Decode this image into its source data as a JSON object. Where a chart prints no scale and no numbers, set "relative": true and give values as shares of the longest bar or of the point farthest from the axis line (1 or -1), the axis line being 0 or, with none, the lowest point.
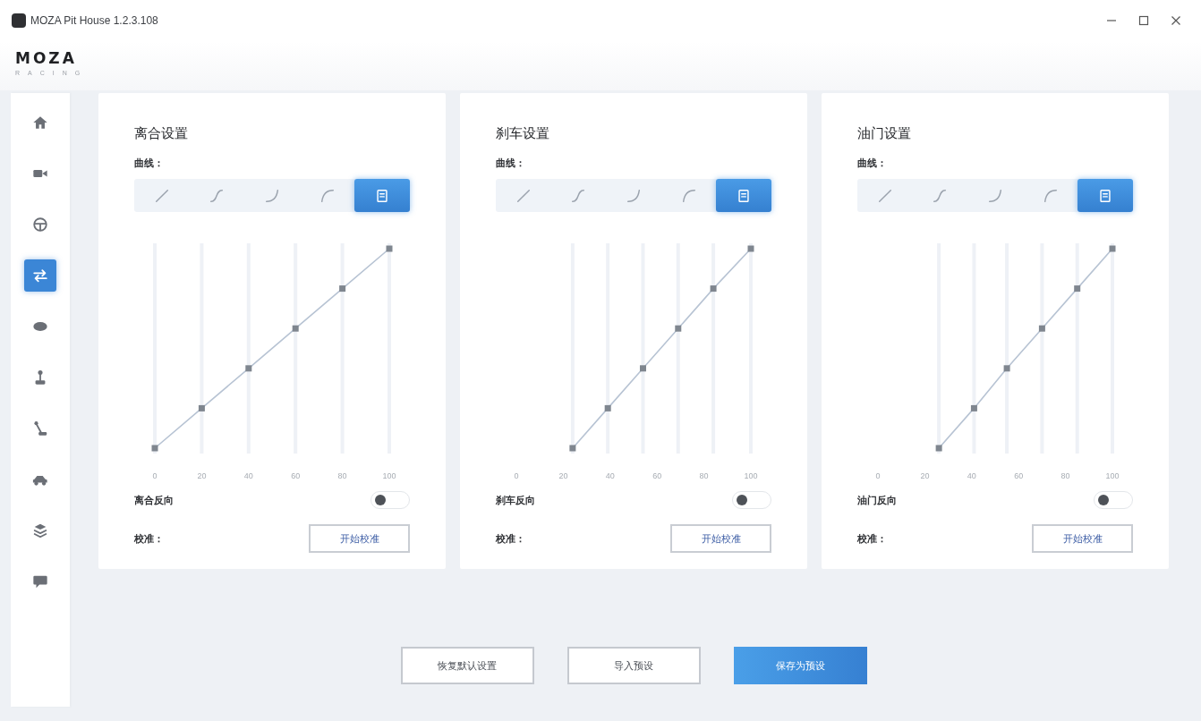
{
  "window": {
    "title": "MOZA Pit House 1.2.3.108"
  },
  "logo": {
    "brand": "MOZA",
    "tagline": "RACING"
  },
  "sidebar": {
    "items": [
      {
        "kind": "home",
        "selected": false
      },
      {
        "kind": "camera",
        "selected": false
      },
      {
        "kind": "wheel",
        "selected": false
      },
      {
        "kind": "arrows",
        "selected": true
      },
      {
        "kind": "oval",
        "selected": false
      },
      {
        "kind": "lever",
        "selected": false
      },
      {
        "kind": "angled-lever",
        "selected": false
      },
      {
        "kind": "car",
        "selected": false
      },
      {
        "kind": "layers",
        "selected": false
      },
      {
        "kind": "chat",
        "selected": false
      }
    ]
  },
  "panels": [
    {
      "title": "离合设置",
      "curve_label": "曲线：",
      "curve_presets": [
        {
          "kind": "linear",
          "selected": false
        },
        {
          "kind": "s-curve",
          "selected": false
        },
        {
          "kind": "concave",
          "selected": false
        },
        {
          "kind": "convex",
          "selected": false
        },
        {
          "kind": "custom",
          "selected": true
        }
      ],
      "chart_data": {
        "type": "line",
        "x": [
          0,
          20,
          40,
          60,
          80,
          100
        ],
        "values": [
          0,
          0.2,
          0.4,
          0.6,
          0.8,
          1
        ],
        "relative": true,
        "color": "#b7c3d3",
        "xticks": [
          0,
          20,
          40,
          60,
          80,
          100
        ],
        "tick_labels": "x",
        "xlim": [
          0,
          100
        ],
        "marker": "square",
        "grid": true
      },
      "reverse": {
        "label": "离合反向",
        "on": false
      },
      "calibration": {
        "label": "校准：",
        "button": "开始校准"
      }
    },
    {
      "title": "刹车设置",
      "curve_label": "曲线：",
      "curve_presets": [
        {
          "kind": "linear",
          "selected": false
        },
        {
          "kind": "s-curve",
          "selected": false
        },
        {
          "kind": "concave",
          "selected": false
        },
        {
          "kind": "convex",
          "selected": false
        },
        {
          "kind": "custom",
          "selected": true
        }
      ],
      "chart_data": {
        "type": "line",
        "x": [
          24,
          39,
          54,
          69,
          84,
          100
        ],
        "values": [
          0,
          0.2,
          0.4,
          0.6,
          0.8,
          1
        ],
        "relative": true,
        "color": "#b7c3d3",
        "xticks": [
          0,
          20,
          40,
          60,
          80,
          100
        ],
        "tick_labels": "x",
        "xlim": [
          0,
          100
        ],
        "marker": "square",
        "grid": true
      },
      "reverse": {
        "label": "刹车反向",
        "on": false
      },
      "calibration": {
        "label": "校准：",
        "button": "开始校准"
      }
    },
    {
      "title": "油门设置",
      "curve_label": "曲线：",
      "curve_presets": [
        {
          "kind": "linear",
          "selected": false
        },
        {
          "kind": "s-curve",
          "selected": false
        },
        {
          "kind": "concave",
          "selected": false
        },
        {
          "kind": "convex",
          "selected": false
        },
        {
          "kind": "custom",
          "selected": true
        }
      ],
      "chart_data": {
        "type": "line",
        "x": [
          26,
          41,
          55,
          70,
          85,
          100
        ],
        "values": [
          0,
          0.2,
          0.4,
          0.6,
          0.8,
          1
        ],
        "relative": true,
        "color": "#b7c3d3",
        "xticks": [
          0,
          20,
          40,
          60,
          80,
          100
        ],
        "tick_labels": "x",
        "xlim": [
          0,
          100
        ],
        "marker": "square",
        "grid": true
      },
      "reverse": {
        "label": "油门反向",
        "on": false
      },
      "calibration": {
        "label": "校准：",
        "button": "开始校准"
      }
    }
  ],
  "actions": [
    {
      "label": "恢复默认设置",
      "kind": "secondary"
    },
    {
      "label": "导入预设",
      "kind": "secondary"
    },
    {
      "label": "保存为预设",
      "kind": "primary"
    }
  ]
}
